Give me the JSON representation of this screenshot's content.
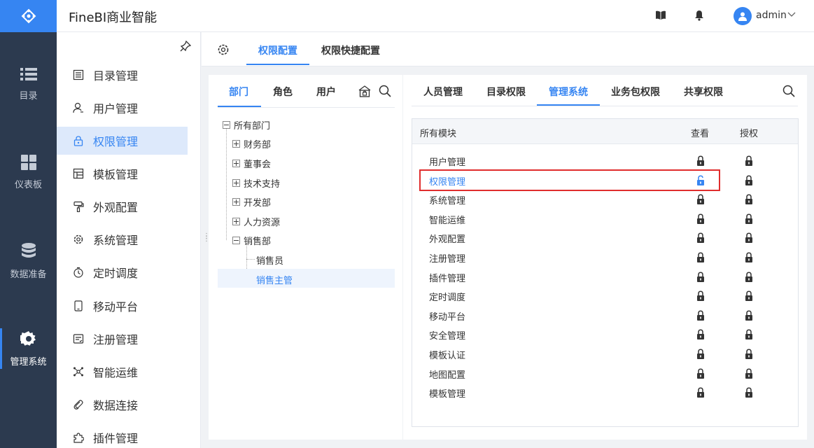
{
  "app": {
    "title": "FineBI商业智能",
    "username": "admin"
  },
  "leftnav": {
    "items": [
      {
        "label": "目录",
        "icon": "list-icon"
      },
      {
        "label": "仪表板",
        "icon": "dashboard-icon"
      },
      {
        "label": "数据准备",
        "icon": "database-icon"
      },
      {
        "label": "管理系统",
        "icon": "gear-icon"
      }
    ],
    "active_index": 3
  },
  "menu": {
    "items": [
      {
        "label": "目录管理",
        "icon": "catalog-icon"
      },
      {
        "label": "用户管理",
        "icon": "user-icon"
      },
      {
        "label": "权限管理",
        "icon": "lock-icon"
      },
      {
        "label": "模板管理",
        "icon": "template-icon"
      },
      {
        "label": "外观配置",
        "icon": "brush-icon"
      },
      {
        "label": "系统管理",
        "icon": "settings-icon"
      },
      {
        "label": "定时调度",
        "icon": "timer-icon"
      },
      {
        "label": "移动平台",
        "icon": "mobile-icon"
      },
      {
        "label": "注册管理",
        "icon": "register-icon"
      },
      {
        "label": "智能运维",
        "icon": "ops-icon"
      },
      {
        "label": "数据连接",
        "icon": "link-icon"
      },
      {
        "label": "插件管理",
        "icon": "plugin-icon"
      }
    ],
    "active_index": 2
  },
  "top_tabs": {
    "items": [
      "权限配置",
      "权限快捷配置"
    ],
    "active_index": 0
  },
  "left_panel": {
    "tabs": [
      "部门",
      "角色",
      "用户"
    ],
    "active_index": 0,
    "tree": {
      "root": "所有部门",
      "nodes": [
        "财务部",
        "董事会",
        "技术支持",
        "开发部",
        "人力资源",
        "销售部"
      ],
      "children": [
        "销售员",
        "销售主管"
      ],
      "selected": "销售主管"
    }
  },
  "right_panel": {
    "tabs": [
      "人员管理",
      "目录权限",
      "管理系统",
      "业务包权限",
      "共享权限"
    ],
    "active_index": 2,
    "table": {
      "headers": {
        "module": "所有模块",
        "view": "查看",
        "grant": "授权"
      },
      "rows": [
        {
          "name": "用户管理",
          "view": "locked",
          "grant": "locked"
        },
        {
          "name": "权限管理",
          "view": "unlocked",
          "grant": "locked"
        },
        {
          "name": "系统管理",
          "view": "locked",
          "grant": "locked"
        },
        {
          "name": "智能运维",
          "view": "locked",
          "grant": "locked"
        },
        {
          "name": "外观配置",
          "view": "locked",
          "grant": "locked"
        },
        {
          "name": "注册管理",
          "view": "locked",
          "grant": "locked"
        },
        {
          "name": "插件管理",
          "view": "locked",
          "grant": "locked"
        },
        {
          "name": "定时调度",
          "view": "locked",
          "grant": "locked"
        },
        {
          "name": "移动平台",
          "view": "locked",
          "grant": "locked"
        },
        {
          "name": "安全管理",
          "view": "locked",
          "grant": "locked"
        },
        {
          "name": "模板认证",
          "view": "locked",
          "grant": "locked"
        },
        {
          "name": "地图配置",
          "view": "locked",
          "grant": "locked"
        },
        {
          "name": "模板管理",
          "view": "locked",
          "grant": "locked"
        }
      ],
      "highlighted_row": 1
    }
  },
  "colors": {
    "accent": "#3685f2",
    "nav_bg": "#2c3a4f",
    "highlight_border": "#e02d2d"
  }
}
